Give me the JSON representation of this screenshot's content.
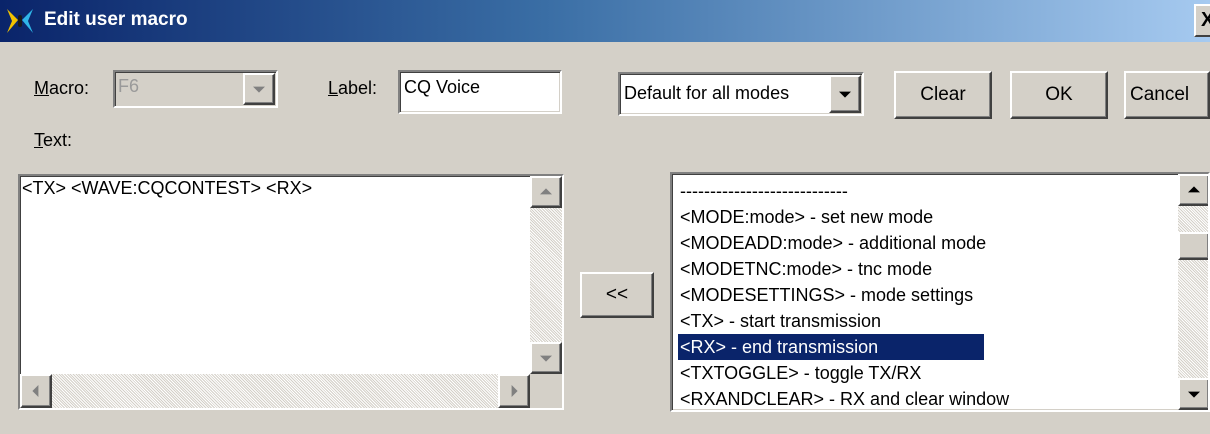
{
  "window": {
    "title": "Edit user macro",
    "close_label": "X"
  },
  "macro": {
    "label_accel": "M",
    "label_rest": "acro:",
    "value": "F6"
  },
  "label_field": {
    "label_accel": "L",
    "label_rest": "abel:",
    "value": "CQ Voice"
  },
  "mode_select": {
    "value": "Default for all modes"
  },
  "buttons": {
    "clear": "Clear",
    "ok": "OK",
    "cancel": "Cancel",
    "insert": "<<"
  },
  "text_area": {
    "label_accel": "T",
    "label_rest": "ext:",
    "value": "<TX> <WAVE:CQCONTEST> <RX>"
  },
  "command_list": {
    "items": [
      "----------------------------",
      "<MODE:mode> - set new mode",
      "<MODEADD:mode> - additional mode",
      "<MODETNC:mode> - tnc mode",
      "<MODESETTINGS> - mode settings",
      "<TX> - start transmission",
      "<RX> - end transmission",
      "<TXTOGGLE> - toggle TX/RX",
      "<RXANDCLEAR> - RX and clear window"
    ],
    "selected_index": 6
  },
  "colors": {
    "title_start": "#0a246a",
    "title_end": "#a6caf0",
    "selection": "#0a246a",
    "face": "#d4d0c8"
  }
}
